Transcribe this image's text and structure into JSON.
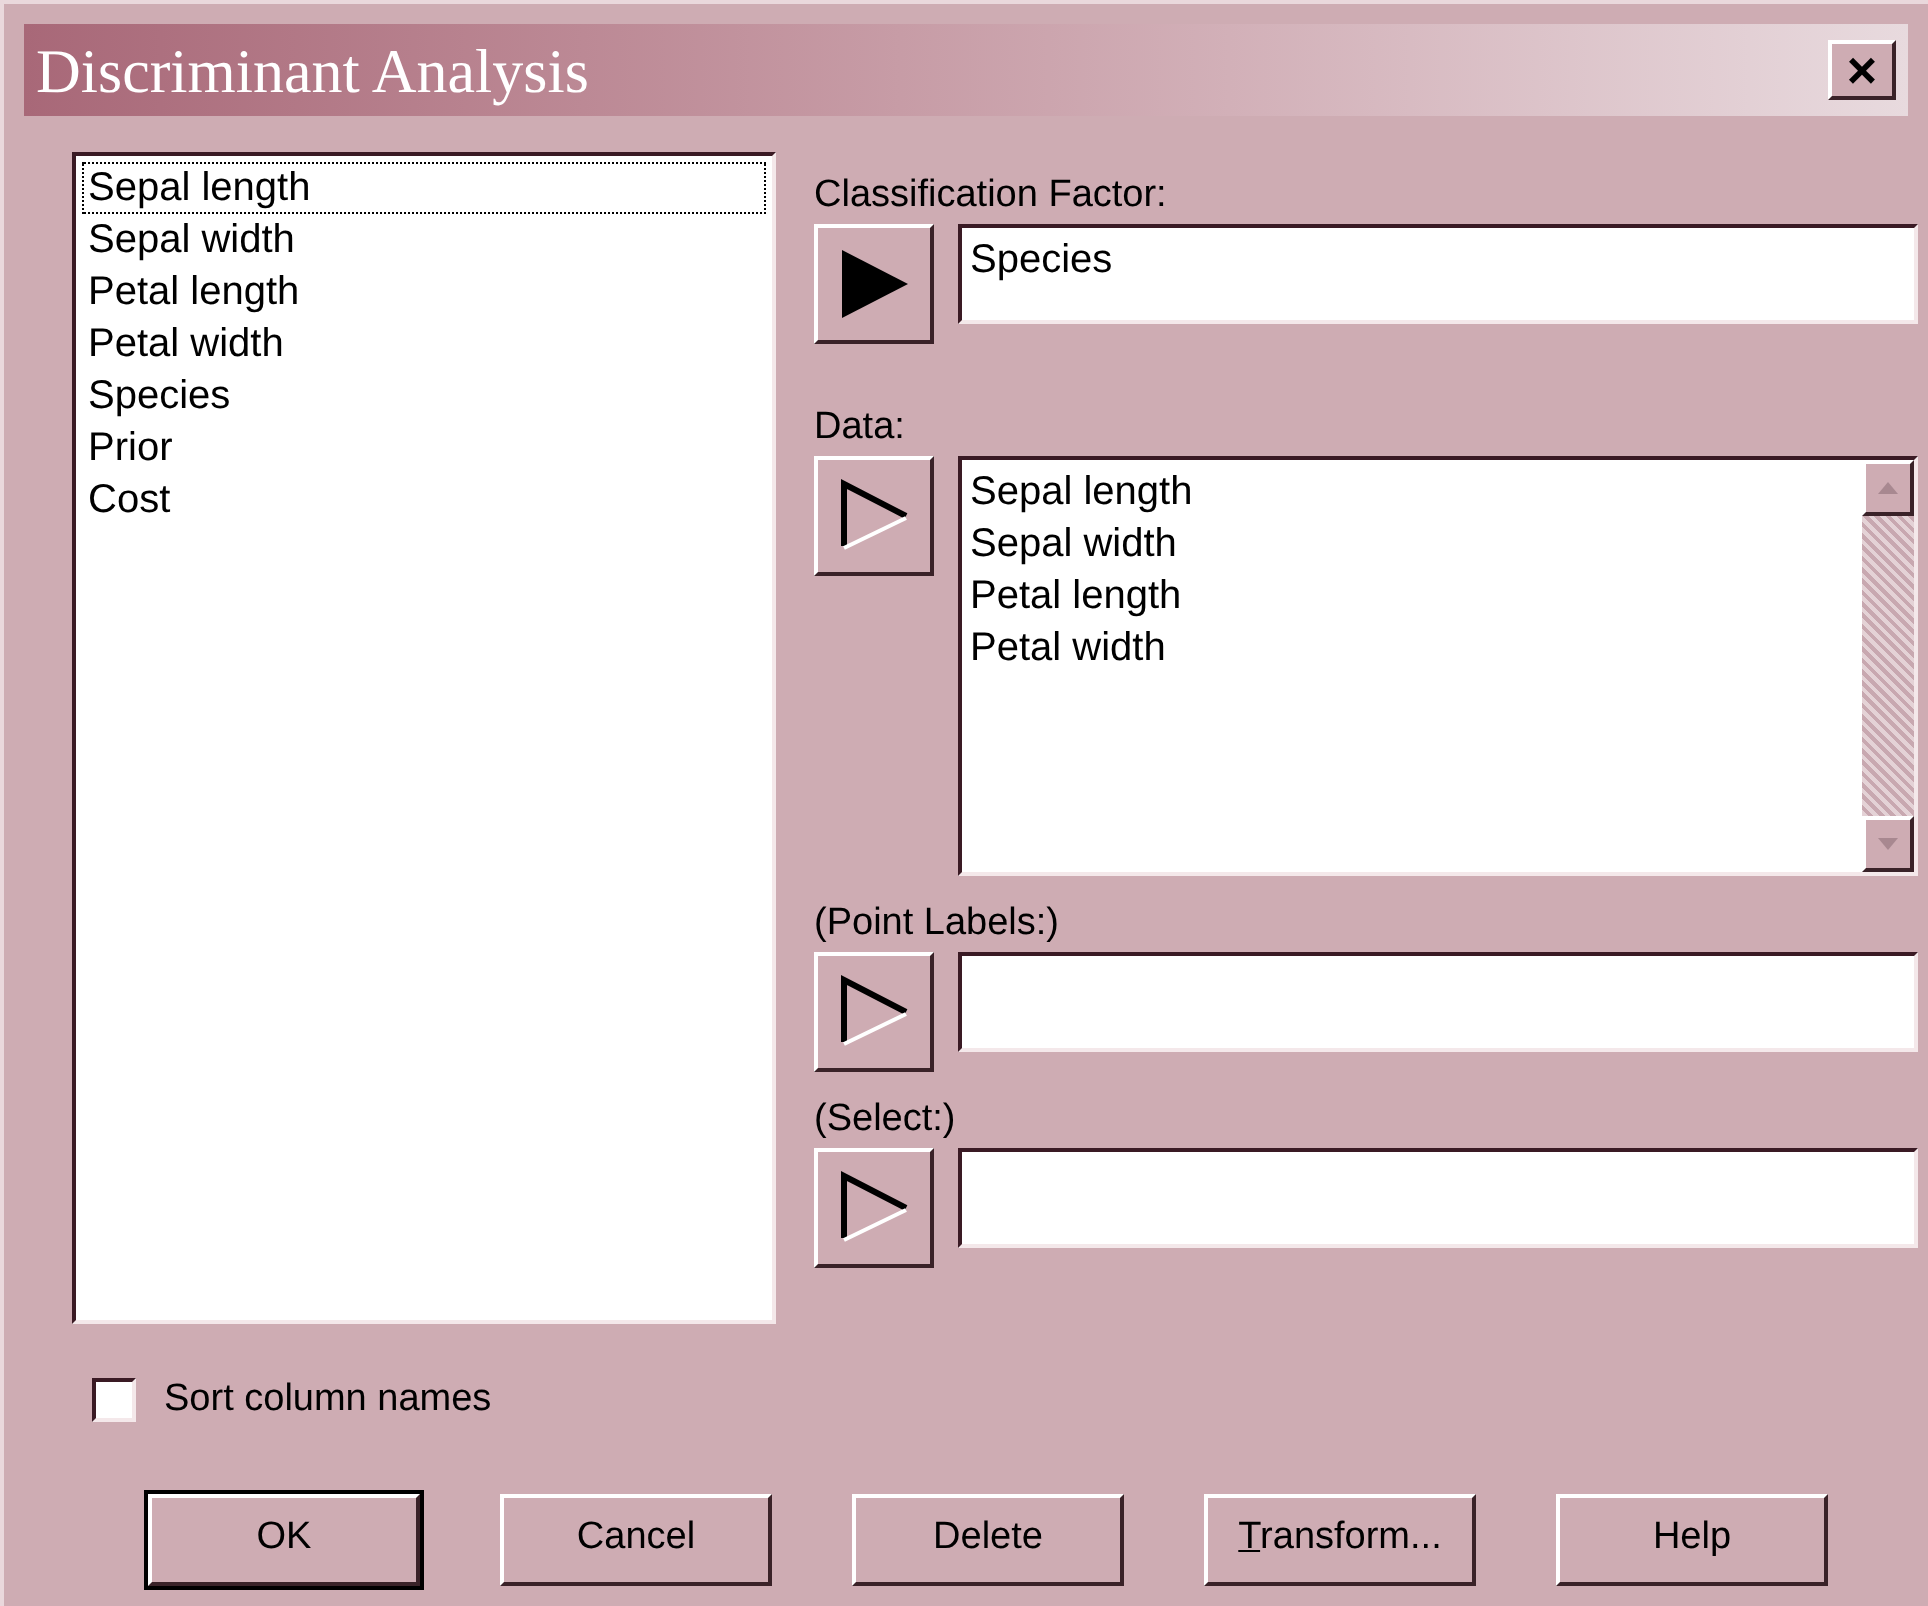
{
  "window": {
    "title": "Discriminant Analysis",
    "close": "×"
  },
  "columns": [
    {
      "label": "Sepal length",
      "focused": true
    },
    {
      "label": "Sepal width",
      "focused": false
    },
    {
      "label": "Petal length",
      "focused": false
    },
    {
      "label": "Petal width",
      "focused": false
    },
    {
      "label": "Species",
      "focused": false
    },
    {
      "label": "Prior",
      "focused": false
    },
    {
      "label": "Cost",
      "focused": false
    }
  ],
  "fields": [
    {
      "kind": "single",
      "label": "Classification Factor:",
      "arrow_active": true,
      "value": "Species"
    },
    {
      "kind": "list",
      "label": "Data:",
      "arrow_active": false,
      "items": [
        "Sepal length",
        "Sepal width",
        "Petal length",
        "Petal width"
      ]
    },
    {
      "kind": "single",
      "label": "(Point Labels:)",
      "arrow_active": false
    },
    {
      "kind": "single",
      "label": "(Select:)",
      "arrow_active": false
    }
  ],
  "sort_checkbox": {
    "label": "Sort column names",
    "checked": false
  },
  "buttons": [
    {
      "label": "OK",
      "default": true,
      "underline_first": false
    },
    {
      "label": "Cancel",
      "default": false,
      "underline_first": false
    },
    {
      "label": "Delete",
      "default": false,
      "underline_first": false
    },
    {
      "label": "Transform...",
      "default": false,
      "underline_first": true
    },
    {
      "label": "Help",
      "default": false,
      "underline_first": false
    }
  ]
}
